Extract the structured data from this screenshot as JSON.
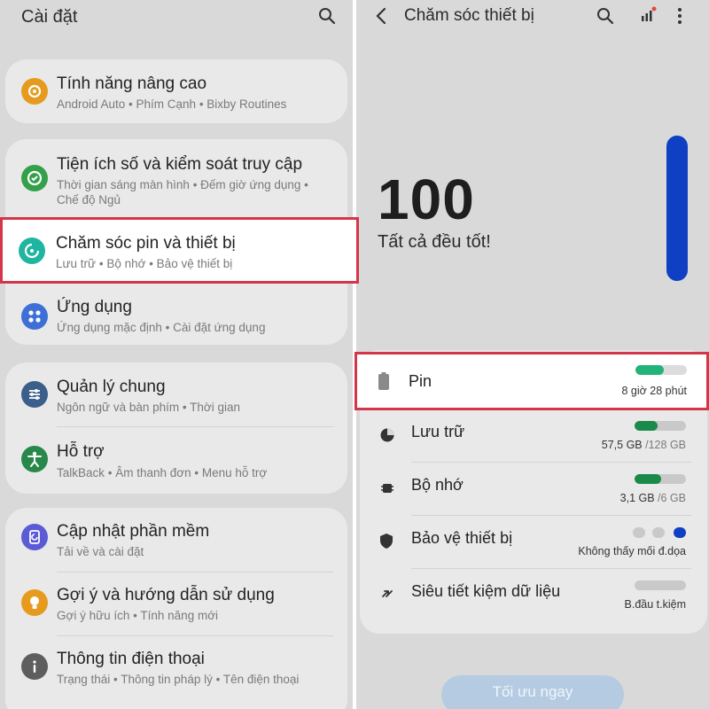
{
  "left": {
    "title": "Cài đặt",
    "items": [
      {
        "title": "Tính năng nâng cao",
        "subtitle": "Android Auto  •  Phím Cạnh  •  Bixby Routines",
        "icon": "gear-plus-icon",
        "color": "#e69b1f"
      },
      {
        "title": "Tiện ích số và kiểm soát truy cập",
        "subtitle": "Thời gian sáng màn hình  •  Đếm giờ ứng dụng  •  Chế độ Ngủ",
        "icon": "digital-wellbeing-icon",
        "color": "#33a04a"
      },
      {
        "title": "Chăm sóc pin và thiết bị",
        "subtitle": "Lưu trữ  •  Bộ nhớ  •  Bảo vệ thiết bị",
        "icon": "device-care-icon",
        "color": "#1fb5a0"
      },
      {
        "title": "Ứng dụng",
        "subtitle": "Ứng dụng mặc định  •  Cài đặt ứng dụng",
        "icon": "apps-grid-icon",
        "color": "#3d6fd6"
      },
      {
        "title": "Quản lý chung",
        "subtitle": "Ngôn ngữ và bàn phím  •  Thời gian",
        "icon": "sliders-icon",
        "color": "#3a5f8a"
      },
      {
        "title": "Hỗ trợ",
        "subtitle": "TalkBack  •  Âm thanh đơn  •  Menu hỗ trợ",
        "icon": "accessibility-icon",
        "color": "#27884a"
      },
      {
        "title": "Cập nhật phần mềm",
        "subtitle": "Tải về và cài đặt",
        "icon": "software-update-icon",
        "color": "#5b5bd6"
      },
      {
        "title": "Gợi ý và hướng dẫn sử dụng",
        "subtitle": "Gợi ý hữu ích  •  Tính năng mới",
        "icon": "lightbulb-icon",
        "color": "#e69b1f"
      },
      {
        "title": "Thông tin điện thoại",
        "subtitle": "Trạng thái  •  Thông tin pháp lý  •  Tên điện thoại",
        "icon": "info-icon",
        "color": "#5e5e5e"
      }
    ]
  },
  "right": {
    "title": "Chăm sóc thiết bị",
    "score": "100",
    "status": "Tất cả đều tốt!",
    "gauge_color": "#0f40c4",
    "rows": [
      {
        "label": "Pin",
        "value": "8 giờ 28 phút",
        "value_muted": "",
        "fill": 0.55,
        "icon": "battery-icon"
      },
      {
        "label": "Lưu trữ",
        "value": "57,5 GB",
        "value_muted": " /128 GB",
        "fill": 0.45,
        "icon": "storage-pie-icon"
      },
      {
        "label": "Bộ nhớ",
        "value": "3,1 GB",
        "value_muted": " /6 GB",
        "fill": 0.52,
        "icon": "memory-chip-icon"
      },
      {
        "label": "Bảo vệ thiết bị",
        "value": "Không thấy mối đ.dọa",
        "value_muted": "",
        "icon": "shield-icon"
      },
      {
        "label": "Siêu tiết kiệm dữ liệu",
        "value": "B.đầu t.kiệm",
        "value_muted": "",
        "fill": 0,
        "icon": "data-saver-icon"
      }
    ],
    "cta": "Tối ưu ngay"
  }
}
